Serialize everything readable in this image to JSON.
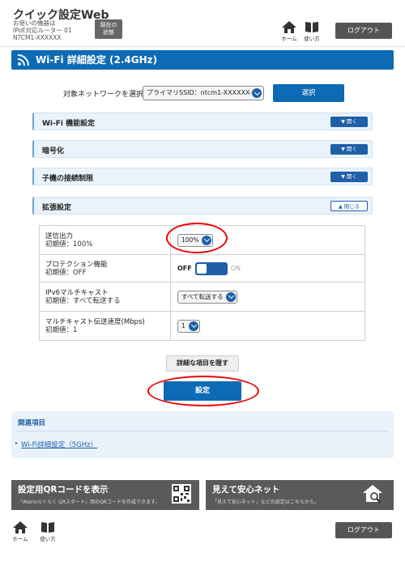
{
  "header": {
    "app_title": "クイック設定Web",
    "device_info": "お使いの機器は\nIPoE対応ルーター 01\nNTCM1-XXXXXX",
    "status_button": "現在の\n状態",
    "home_label": "ホーム",
    "manual_label": "使い方",
    "logout_label": "ログアウト"
  },
  "section": {
    "title": "Wi-Fi 詳細設定 (2.4GHz)"
  },
  "network": {
    "label": "対象ネットワークを選択",
    "selected": "プライマリSSID：ntcm1-XXXXXX-g",
    "select_button": "選択"
  },
  "accordions": [
    {
      "label": "Wi-Fi 機能設定",
      "button": "開く"
    },
    {
      "label": "暗号化",
      "button": "開く"
    },
    {
      "label": "子機の接続制限",
      "button": "開く"
    },
    {
      "label": "拡張設定",
      "button": "閉じる"
    }
  ],
  "settings": [
    {
      "label": "送信出力",
      "default": "初期値：100%",
      "value": "100%"
    },
    {
      "label": "プロテクション機能",
      "default": "初期値：OFF",
      "off": "OFF",
      "on": "ON"
    },
    {
      "label": "IPv6マルチキャスト",
      "default": "初期値：すべて転送する",
      "value": "すべて転送する"
    },
    {
      "label": "マルチキャスト伝送速度(Mbps)",
      "default": "初期値：1",
      "value": "1"
    }
  ],
  "buttons": {
    "hide_details": "詳細な項目を隠す",
    "submit": "設定"
  },
  "related": {
    "title": "関連項目",
    "link": "Wi-Fi詳細設定（5GHz）"
  },
  "promos": [
    {
      "title": "設定用QRコードを表示",
      "sub": "「Atermらくらく QRスタート」用のQRコードを作成できます。"
    },
    {
      "title": "見えて安心ネット",
      "sub": "「見えて安心ネット」などの設定はこちらから。"
    }
  ],
  "colors": {
    "primary": "#0d6ab4",
    "accent_light": "#eaf3fb",
    "highlight": "#e00000",
    "dark_button": "#555555"
  }
}
